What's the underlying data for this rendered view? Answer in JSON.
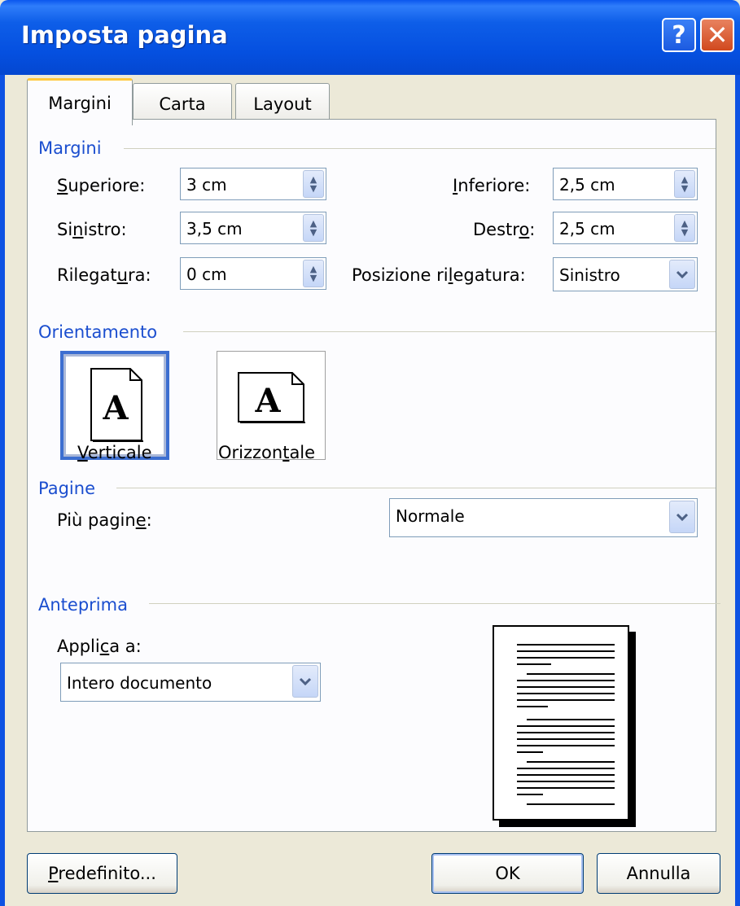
{
  "window": {
    "title": "Imposta pagina"
  },
  "titlebar_buttons": {
    "help": "?",
    "close": "✕"
  },
  "tabs": [
    {
      "label": "Margini",
      "active": true
    },
    {
      "label": "Carta",
      "active": false
    },
    {
      "label": "Layout",
      "active": false
    }
  ],
  "margins_group": {
    "title": "Margini",
    "superiore": {
      "label_u": "S",
      "label_rest": "uperiore:",
      "value": "3 cm"
    },
    "inferiore": {
      "label_u": "I",
      "label_rest": "nferiore:",
      "value": "2,5 cm"
    },
    "sinistro": {
      "label_pre": "Si",
      "label_u": "n",
      "label_rest": "istro:",
      "value": "3,5 cm"
    },
    "destro": {
      "label_pre": "Destr",
      "label_u": "o",
      "label_rest": ":",
      "value": "2,5 cm"
    },
    "rilegatura": {
      "label_pre": "Rilegat",
      "label_u": "u",
      "label_rest": "ra:",
      "value": "0 cm"
    },
    "posizione": {
      "label_pre": "Posizione ri",
      "label_u": "l",
      "label_rest": "egatura:",
      "value": "Sinistro"
    }
  },
  "orientation_group": {
    "title": "Orientamento",
    "vertical": {
      "label_u": "V",
      "label_rest": "erticale",
      "selected": true
    },
    "horizontal": {
      "label_pre": "Orizzon",
      "label_u": "t",
      "label_rest": "ale",
      "selected": false
    },
    "glyph": "A"
  },
  "pages_group": {
    "title": "Pagine",
    "label_pre": "Più pagin",
    "label_u": "e",
    "label_rest": ":",
    "value": "Normale"
  },
  "preview_group": {
    "title": "Anteprima",
    "apply_label_pre": "Appli",
    "apply_label_u": "c",
    "apply_label_rest": "a a:",
    "apply_value": "Intero documento"
  },
  "buttons": {
    "default_u": "P",
    "default_rest": "redefinito...",
    "ok": "OK",
    "cancel": "Annulla"
  },
  "colors": {
    "title_bar": "#0550e0",
    "group_label": "#1b4ecf",
    "dialog_bg": "#ece9d8"
  }
}
